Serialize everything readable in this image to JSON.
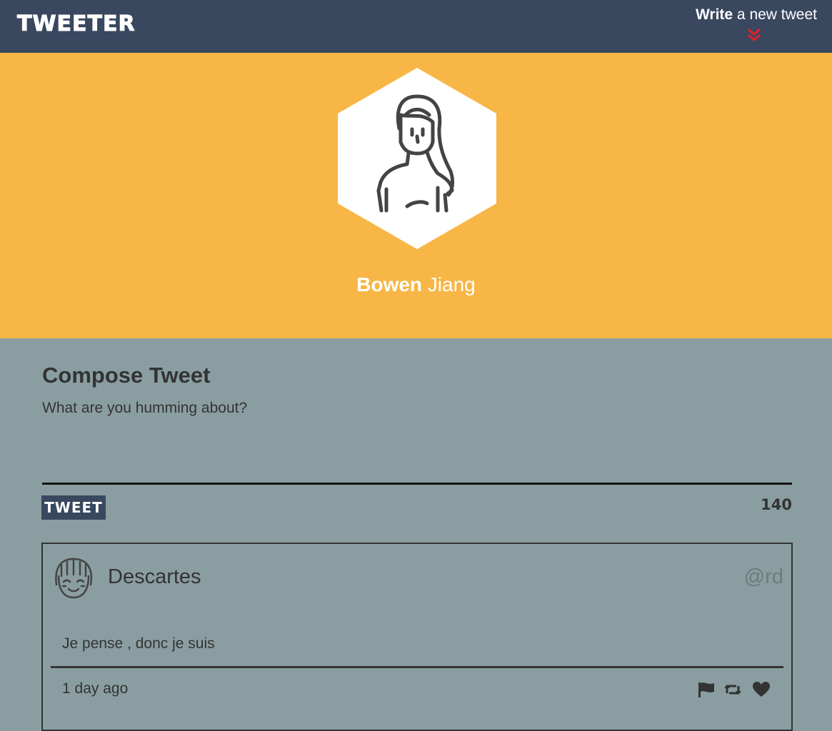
{
  "nav": {
    "brand": "TWEETER",
    "write_bold": "Write",
    "write_rest": " a new tweet",
    "chevron_icon": "double-chevron-down-icon",
    "chevron_color": "#e8202a"
  },
  "profile": {
    "first_name": "Bowen",
    "last_name": " Jiang",
    "avatar_icon": "woman-avatar-icon",
    "background_color": "#f7b645"
  },
  "compose": {
    "title": "Compose Tweet",
    "placeholder": "What are you humming about?",
    "submit_label": "TWEET",
    "counter": "140"
  },
  "tweets": [
    {
      "author": "Descartes",
      "handle": "@rd",
      "text": "Je pense , donc je suis",
      "time": "1 day ago",
      "avatar_icon": "smiling-girl-avatar-icon",
      "actions": [
        "flag-icon",
        "retweet-icon",
        "heart-icon"
      ]
    }
  ],
  "colors": {
    "nav": "#39475f",
    "page": "#8a9ea1",
    "text": "#333333"
  }
}
